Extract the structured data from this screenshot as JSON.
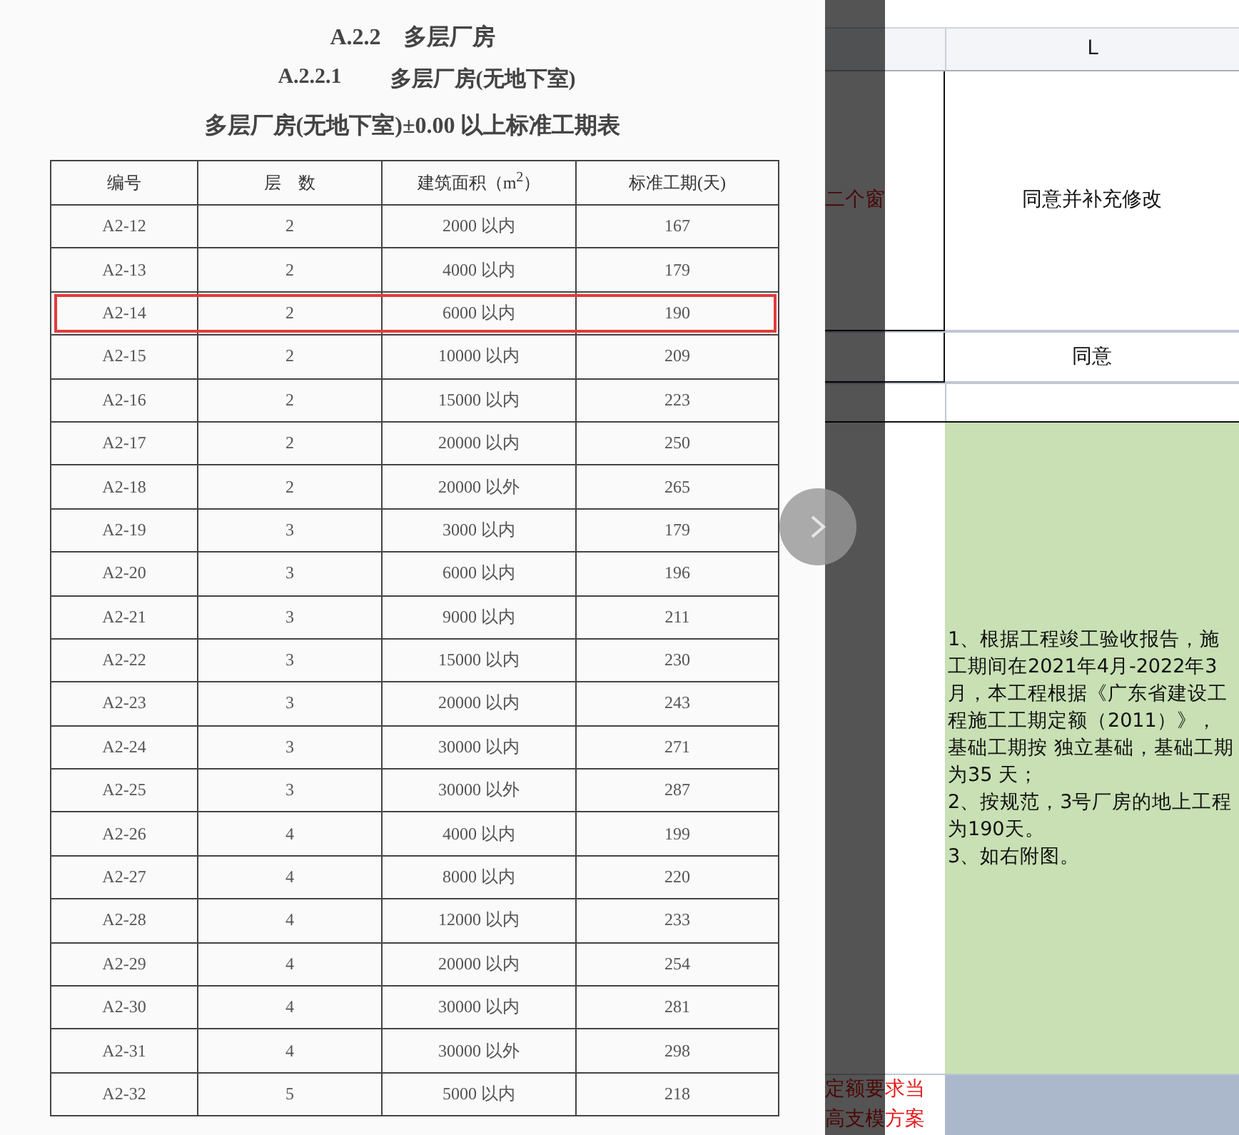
{
  "document": {
    "heading": "A.2.2　多层厂房",
    "subheading_number": "A.2.2.1",
    "subheading_title": "多层厂房(无地下室)",
    "table_title": "多层厂房(无地下室)±0.00 以上标准工期表",
    "table": {
      "columns": [
        "编号",
        "层　数",
        "建筑面积（m$^{2}$）",
        "标准工期(天)"
      ],
      "rows": [
        {
          "cells": [
            "A2-12",
            "2",
            "2000 以内",
            "167"
          ],
          "highlighted": false
        },
        {
          "cells": [
            "A2-13",
            "2",
            "4000 以内",
            "179"
          ],
          "highlighted": false
        },
        {
          "cells": [
            "A2-14",
            "2",
            "6000 以内",
            "190"
          ],
          "highlighted": true
        },
        {
          "cells": [
            "A2-15",
            "2",
            "10000 以内",
            "209"
          ],
          "highlighted": false
        },
        {
          "cells": [
            "A2-16",
            "2",
            "15000 以内",
            "223"
          ],
          "highlighted": false
        },
        {
          "cells": [
            "A2-17",
            "2",
            "20000 以内",
            "250"
          ],
          "highlighted": false
        },
        {
          "cells": [
            "A2-18",
            "2",
            "20000 以外",
            "265"
          ],
          "highlighted": false
        },
        {
          "cells": [
            "A2-19",
            "3",
            "3000 以内",
            "179"
          ],
          "highlighted": false
        },
        {
          "cells": [
            "A2-20",
            "3",
            "6000 以内",
            "196"
          ],
          "highlighted": false
        },
        {
          "cells": [
            "A2-21",
            "3",
            "9000 以内",
            "211"
          ],
          "highlighted": false
        },
        {
          "cells": [
            "A2-22",
            "3",
            "15000 以内",
            "230"
          ],
          "highlighted": false
        },
        {
          "cells": [
            "A2-23",
            "3",
            "20000 以内",
            "243"
          ],
          "highlighted": false
        },
        {
          "cells": [
            "A2-24",
            "3",
            "30000 以内",
            "271"
          ],
          "highlighted": false
        },
        {
          "cells": [
            "A2-25",
            "3",
            "30000 以外",
            "287"
          ],
          "highlighted": false
        },
        {
          "cells": [
            "A2-26",
            "4",
            "4000 以内",
            "199"
          ],
          "highlighted": false
        },
        {
          "cells": [
            "A2-27",
            "4",
            "8000 以内",
            "220"
          ],
          "highlighted": false
        },
        {
          "cells": [
            "A2-28",
            "4",
            "12000 以内",
            "233"
          ],
          "highlighted": false
        },
        {
          "cells": [
            "A2-29",
            "4",
            "20000 以内",
            "254"
          ],
          "highlighted": false
        },
        {
          "cells": [
            "A2-30",
            "4",
            "30000 以内",
            "281"
          ],
          "highlighted": false
        },
        {
          "cells": [
            "A2-31",
            "4",
            "30000 以外",
            "298"
          ],
          "highlighted": false
        },
        {
          "cells": [
            "A2-32",
            "5",
            "5000 以内",
            "218"
          ],
          "highlighted": false
        }
      ]
    }
  },
  "spreadsheet": {
    "column_header": "L",
    "rows": [
      {
        "column_1": "二个窗",
        "column_l": "同意并补充修改",
        "kind": "plain"
      },
      {
        "column_l": "同意",
        "kind": "plain"
      },
      {
        "kind": "empty"
      },
      {
        "column_l_paragraphs": [
          "1、根据工程竣工验收报告，施工期间在2021年4月-2022年3月，本工程根据《广东省建设工程施工工期定额（2011）》，基础工期按 独立基础，基础工期为35 天；",
          "2、按规范，3号厂房的地上工程为190天。",
          "3、如右附图。"
        ],
        "kind": "green"
      },
      {
        "column_1": "定额要求当高支模方案",
        "kind": "shaded"
      }
    ]
  }
}
